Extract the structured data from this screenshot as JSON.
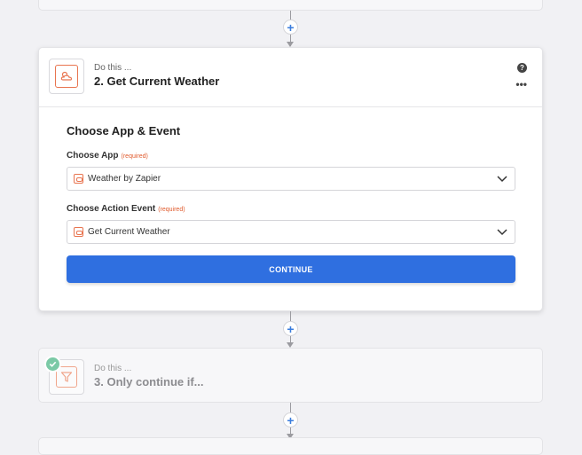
{
  "connectors": {
    "add_label": "+"
  },
  "main_step": {
    "prefix": "Do this ...",
    "title": "2. Get Current Weather",
    "help_label": "?",
    "more_label": "•••",
    "section_title": "Choose App & Event",
    "app_field": {
      "label": "Choose App",
      "required": "(required)",
      "value": "Weather by Zapier"
    },
    "event_field": {
      "label": "Choose Action Event",
      "required": "(required)",
      "value": "Get Current Weather"
    },
    "continue_label": "CONTINUE"
  },
  "next_step": {
    "prefix": "Do this ...",
    "title": "3. Only continue if..."
  },
  "colors": {
    "accent": "#2f6fe0",
    "brand_orange": "#e8744f",
    "success": "#7bc9a6",
    "background": "#f1f1f4"
  },
  "icons": {
    "app": "weather-cloud-icon",
    "filter": "filter-funnel-icon",
    "check": "check-icon",
    "help": "help-icon",
    "more": "more-options-icon",
    "dropdown": "chevron-down-icon"
  }
}
